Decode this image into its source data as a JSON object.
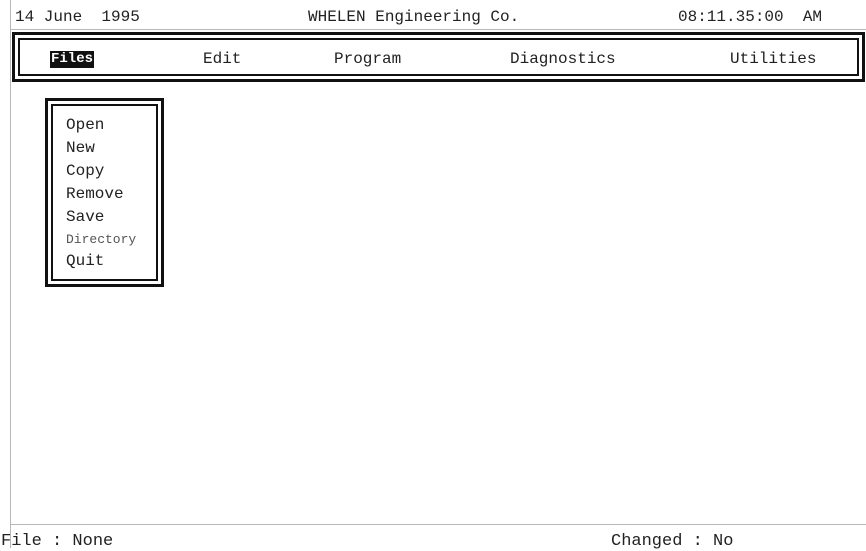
{
  "status_top": {
    "date": "14 June  1995",
    "company": "WHELEN Engineering Co.",
    "time": "08:11.35:00  AM"
  },
  "menu": {
    "items": [
      {
        "label": "Files",
        "active": true
      },
      {
        "label": "Edit",
        "active": false
      },
      {
        "label": "Program",
        "active": false
      },
      {
        "label": "Diagnostics",
        "active": false
      },
      {
        "label": "Utilities",
        "active": false
      }
    ]
  },
  "files_dropdown": {
    "items": [
      "Open",
      "New",
      "Copy",
      "Remove",
      "Save",
      "Directory",
      "Quit"
    ]
  },
  "status_bottom": {
    "file": "File : None",
    "changed": "Changed : No"
  }
}
